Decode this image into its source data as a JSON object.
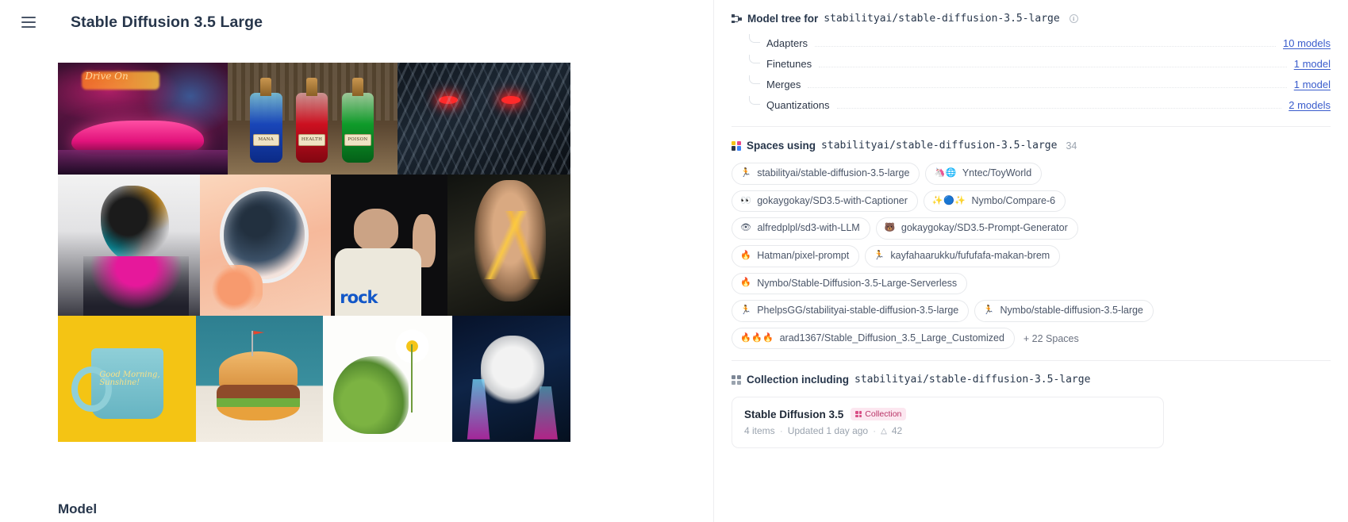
{
  "header": {
    "menu_icon": "hamburger-icon",
    "title": "Stable Diffusion 3.5 Large"
  },
  "left": {
    "section_heading": "Model",
    "gallery": [
      {
        "name": "neon-garage-pink-sportscar",
        "caption": "Drive On"
      },
      {
        "name": "potion-bottles-shelf",
        "labels": [
          "MANA",
          "HEALTH",
          "POISON"
        ]
      },
      {
        "name": "black-chrome-robot-red-eyes"
      },
      {
        "name": "paint-splash-portrait-city"
      },
      {
        "name": "anime-astronaut-girl-flowers"
      },
      {
        "name": "man-peace-sign-rock-tshirt",
        "caption": "rock"
      },
      {
        "name": "woman-gold-paint-face"
      },
      {
        "name": "good-morning-coffee-mug",
        "caption": "Good Morning, Sunshine!"
      },
      {
        "name": "cute-3d-burger-flag"
      },
      {
        "name": "cartoon-dragon-daisy-sketch"
      },
      {
        "name": "panda-science-lab-flasks"
      }
    ]
  },
  "model_tree": {
    "icon": "tree-icon",
    "title": "Model tree for",
    "repo": "stabilityai/stable-diffusion-3.5-large",
    "info_icon": "info-icon",
    "rows": [
      {
        "label": "Adapters",
        "count": "10 models"
      },
      {
        "label": "Finetunes",
        "count": "1 model"
      },
      {
        "label": "Merges",
        "count": "1 model"
      },
      {
        "label": "Quantizations",
        "count": "2 models"
      }
    ]
  },
  "spaces": {
    "icon": "spaces-grid-icon",
    "title": "Spaces using",
    "repo": "stabilityai/stable-diffusion-3.5-large",
    "count": "34",
    "items": [
      {
        "emoji": "🏃",
        "label": "stabilityai/stable-diffusion-3.5-large"
      },
      {
        "emoji": "🦄🌐",
        "label": "Yntec/ToyWorld"
      },
      {
        "emoji": "👀",
        "label": "gokaygokay/SD3.5-with-Captioner"
      },
      {
        "emoji": "✨🔵✨",
        "label": "Nymbo/Compare-6"
      },
      {
        "emoji": "👁",
        "label": "alfredplpl/sd3-with-LLM"
      },
      {
        "emoji": "🐻",
        "label": "gokaygokay/SD3.5-Prompt-Generator"
      },
      {
        "emoji": "🔥",
        "label": "Hatman/pixel-prompt"
      },
      {
        "emoji": "🏃",
        "label": "kayfahaarukku/fufufafa-makan-brem"
      },
      {
        "emoji": "🔥",
        "label": "Nymbo/Stable-Diffusion-3.5-Large-Serverless"
      },
      {
        "emoji": "🏃",
        "label": "PhelpsGG/stabilityai-stable-diffusion-3.5-large"
      },
      {
        "emoji": "🏃",
        "label": "Nymbo/stable-diffusion-3.5-large"
      },
      {
        "emoji": "🔥🔥🔥",
        "label": "arad1367/Stable_Diffusion_3.5_Large_Customized"
      }
    ],
    "more_label": "+ 22 Spaces"
  },
  "collection": {
    "icon": "collection-grid-icon",
    "title": "Collection including",
    "repo": "stabilityai/stable-diffusion-3.5-large",
    "card": {
      "name": "Stable Diffusion 3.5",
      "tag": "Collection",
      "items": "4 items",
      "updated": "Updated 1 day ago",
      "likes": "42",
      "likes_icon": "upvote-triangle-icon",
      "sep": "·"
    }
  },
  "colors": {
    "accent_link": "#3a5ccc",
    "text_primary": "#27364b",
    "text_muted": "#9aa3ae",
    "border": "#ededf0",
    "collection_tag_bg": "#fce7f0",
    "collection_tag_fg": "#b83366"
  }
}
